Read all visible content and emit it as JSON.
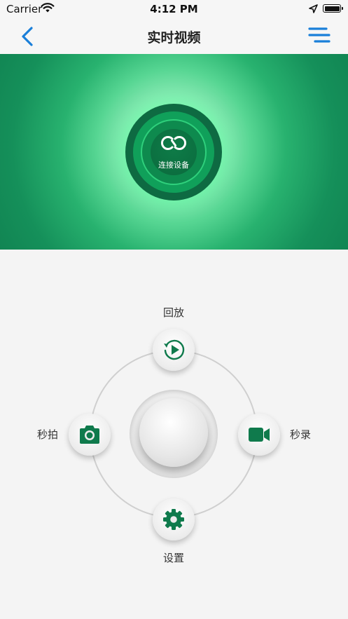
{
  "status_bar": {
    "carrier": "Carrier",
    "time": "4:12 PM",
    "wifi_icon": "wifi-icon",
    "location_icon": "location-arrow-icon",
    "battery_icon": "battery-icon"
  },
  "nav": {
    "title": "实时视频",
    "back_icon": "chevron-left-icon",
    "menu_icon": "menu-icon",
    "accent_color": "#1a7fd9"
  },
  "video": {
    "connect_label": "连接设备",
    "connect_icon": "link-icon",
    "brand_color": "#0f7f4f"
  },
  "controls": {
    "playback_label": "回放",
    "snapshot_label": "秒拍",
    "record_label": "秒录",
    "settings_label": "设置",
    "playback_icon": "replay-icon",
    "snapshot_icon": "camera-icon",
    "record_icon": "video-camera-icon",
    "settings_icon": "gear-icon",
    "icon_color": "#0f7a4c"
  }
}
